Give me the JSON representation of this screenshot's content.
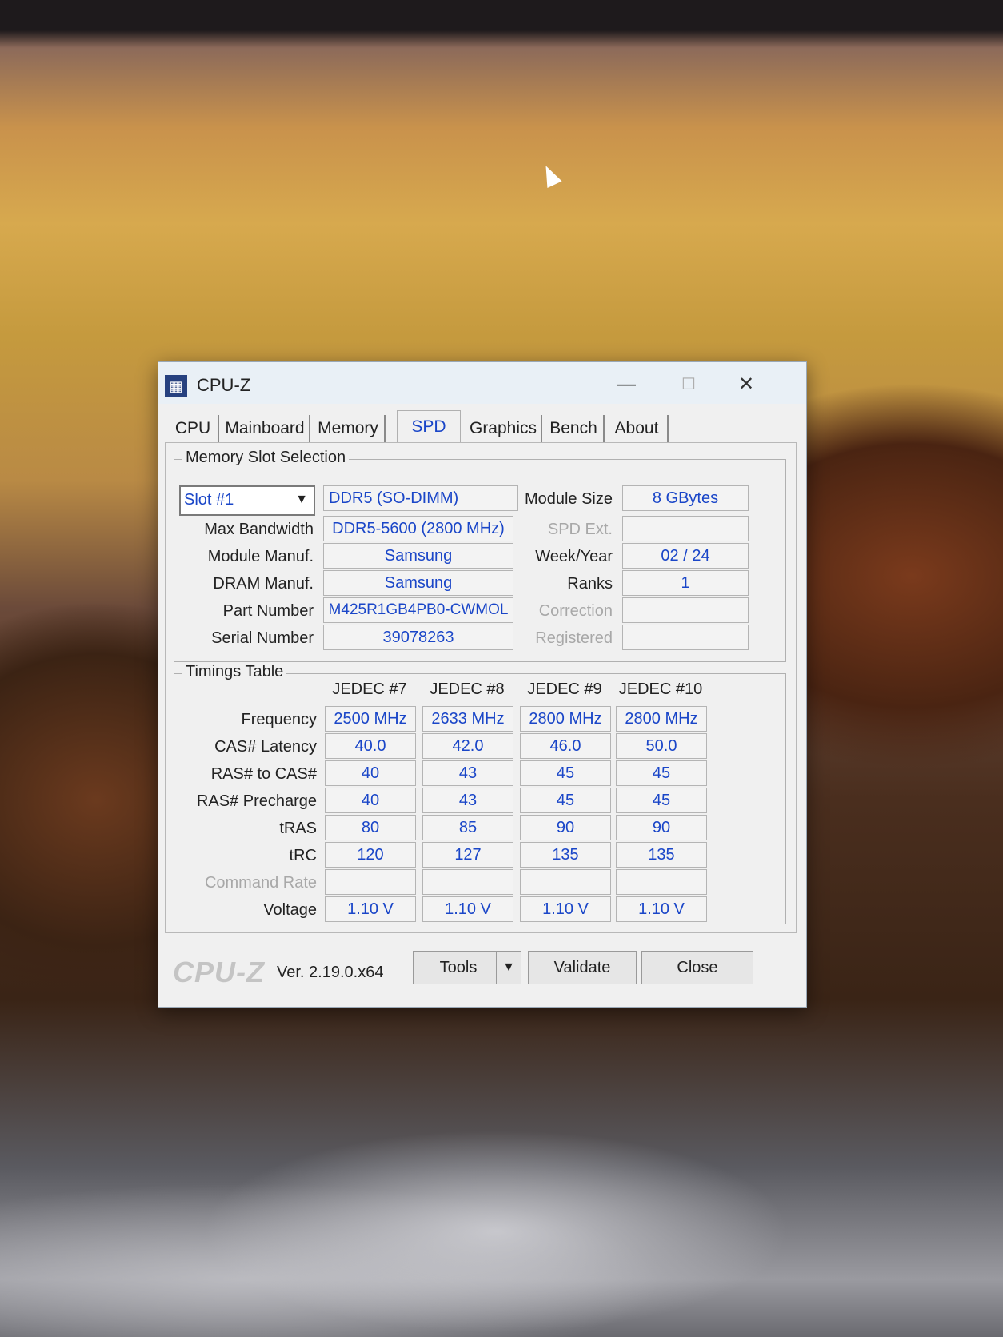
{
  "window": {
    "title": "CPU-Z",
    "minimize": "—",
    "maximize": "☐",
    "close": "✕",
    "icon": "cpu-z-app-icon"
  },
  "tabs": [
    "CPU",
    "Mainboard",
    "Memory",
    "SPD",
    "Graphics",
    "Bench",
    "About"
  ],
  "active_tab": "SPD",
  "slot_selection": {
    "group_title": "Memory Slot Selection",
    "slot": "Slot #1",
    "module_type": "DDR5 (SO-DIMM)",
    "labels": {
      "max_bandwidth": "Max Bandwidth",
      "module_manuf": "Module Manuf.",
      "dram_manuf": "DRAM Manuf.",
      "part_number": "Part Number",
      "serial_number": "Serial Number",
      "module_size": "Module Size",
      "spd_ext": "SPD Ext.",
      "week_year": "Week/Year",
      "ranks": "Ranks",
      "correction": "Correction",
      "registered": "Registered"
    },
    "values": {
      "max_bandwidth": "DDR5-5600 (2800 MHz)",
      "module_manuf": "Samsung",
      "dram_manuf": "Samsung",
      "part_number": "M425R1GB4PB0-CWMOL",
      "serial_number": "39078263",
      "module_size": "8 GBytes",
      "spd_ext": "",
      "week_year": "02 / 24",
      "ranks": "1",
      "correction": "",
      "registered": ""
    }
  },
  "timings": {
    "group_title": "Timings Table",
    "columns": [
      "JEDEC #7",
      "JEDEC #8",
      "JEDEC #9",
      "JEDEC #10"
    ],
    "rows": [
      {
        "label": "Frequency",
        "values": [
          "2500 MHz",
          "2633 MHz",
          "2800 MHz",
          "2800 MHz"
        ]
      },
      {
        "label": "CAS# Latency",
        "values": [
          "40.0",
          "42.0",
          "46.0",
          "50.0"
        ]
      },
      {
        "label": "RAS# to CAS#",
        "values": [
          "40",
          "43",
          "45",
          "45"
        ]
      },
      {
        "label": "RAS# Precharge",
        "values": [
          "40",
          "43",
          "45",
          "45"
        ]
      },
      {
        "label": "tRAS",
        "values": [
          "80",
          "85",
          "90",
          "90"
        ]
      },
      {
        "label": "tRC",
        "values": [
          "120",
          "127",
          "135",
          "135"
        ]
      },
      {
        "label": "Command Rate",
        "values": [
          "",
          "",
          "",
          ""
        ]
      },
      {
        "label": "Voltage",
        "values": [
          "1.10 V",
          "1.10 V",
          "1.10 V",
          "1.10 V"
        ]
      }
    ]
  },
  "footer": {
    "brand": "CPU-Z",
    "version": "Ver. 2.19.0.x64",
    "tools": "Tools",
    "validate": "Validate",
    "close": "Close"
  }
}
